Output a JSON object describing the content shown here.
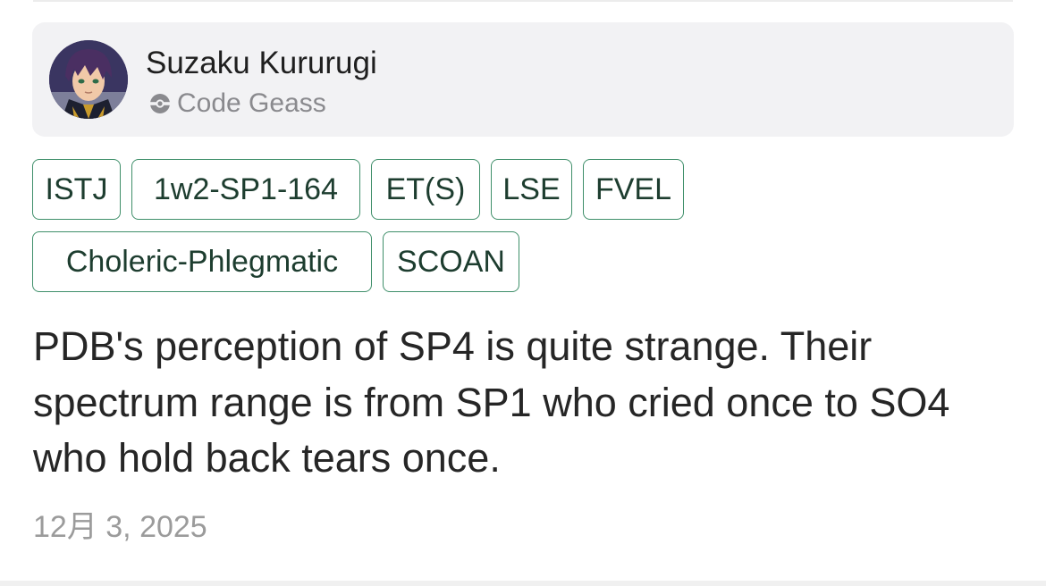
{
  "profile": {
    "name": "Suzaku Kururugi",
    "source": "Code Geass",
    "source_icon": "pokeball-icon",
    "avatar": "character-avatar"
  },
  "tags": [
    "ISTJ",
    "1w2-SP1-164",
    "ET(S)",
    "LSE",
    "FVEL",
    "Choleric-Phlegmatic",
    "SCOAN"
  ],
  "comment": {
    "text": "PDB's perception of SP4 is quite strange. Their spectrum range is from SP1 who cried once to SO4 who hold back tears once."
  },
  "date": "12月 3, 2025",
  "colors": {
    "card_background": "#f2f2f4",
    "tag_border": "#3f8f6a",
    "tag_text": "#1d3d2f",
    "comment_text": "#262626",
    "muted_text": "#8a8a8e"
  }
}
